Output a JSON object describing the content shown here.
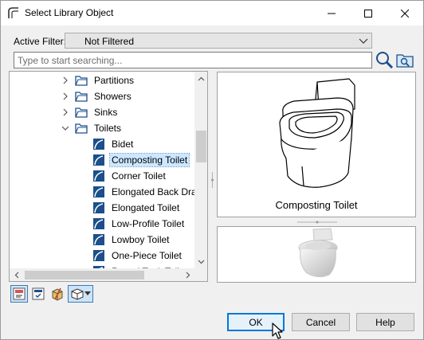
{
  "window": {
    "title": "Select Library Object"
  },
  "filter": {
    "label": "Active Filter:",
    "value": "Not Filtered"
  },
  "search": {
    "placeholder": "Type to start searching...",
    "value": ""
  },
  "tree": {
    "items": [
      {
        "label": "Partitions",
        "type": "folder",
        "expanded": false
      },
      {
        "label": "Showers",
        "type": "folder",
        "expanded": false
      },
      {
        "label": "Sinks",
        "type": "folder",
        "expanded": false
      },
      {
        "label": "Toilets",
        "type": "folder",
        "expanded": true
      },
      {
        "label": "Bidet",
        "type": "object"
      },
      {
        "label": "Composting Toilet",
        "type": "object",
        "selected": true
      },
      {
        "label": "Corner Toilet",
        "type": "object"
      },
      {
        "label": "Elongated Back Drain",
        "type": "object"
      },
      {
        "label": "Elongated Toilet",
        "type": "object"
      },
      {
        "label": "Low-Profile Toilet",
        "type": "object"
      },
      {
        "label": "Lowboy Toilet",
        "type": "object"
      },
      {
        "label": "One-Piece Toilet",
        "type": "object"
      },
      {
        "label": "Round Tank Toilet",
        "type": "object"
      }
    ]
  },
  "preview": {
    "caption": "Composting Toilet"
  },
  "toolbar": {
    "icons": [
      "place-object-icon",
      "library-check-icon",
      "material-icon",
      "view-options-icon"
    ]
  },
  "buttons": {
    "ok": "OK",
    "cancel": "Cancel",
    "help": "Help"
  },
  "colors": {
    "accent": "#0078d7",
    "selection": "#cce8ff",
    "folder_icon": "#1c4f8c"
  }
}
